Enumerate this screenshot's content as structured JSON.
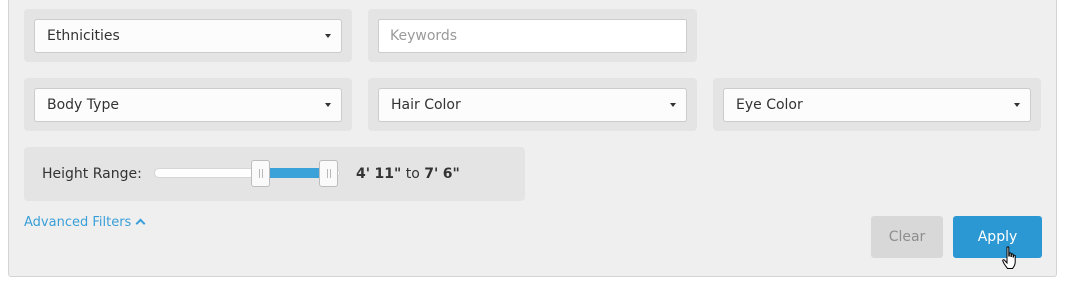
{
  "filters": {
    "ethnicities": {
      "label": "Ethnicities"
    },
    "keywords": {
      "placeholder": "Keywords",
      "value": ""
    },
    "body_type": {
      "label": "Body Type"
    },
    "hair_color": {
      "label": "Hair Color"
    },
    "eye_color": {
      "label": "Eye Color"
    }
  },
  "height_range": {
    "label": "Height Range:",
    "min_ft": "4'",
    "min_in": "11\"",
    "connector": "to",
    "max_ft": "7'",
    "max_in": "6\"",
    "selected_fraction": [
      0.575,
      0.94
    ]
  },
  "advanced_filters": {
    "label": "Advanced Filters"
  },
  "actions": {
    "clear_label": "Clear",
    "apply_label": "Apply"
  },
  "colors": {
    "accent": "#2c98d3",
    "link": "#3a9fd8",
    "range_fill": "#3aa1d9"
  }
}
